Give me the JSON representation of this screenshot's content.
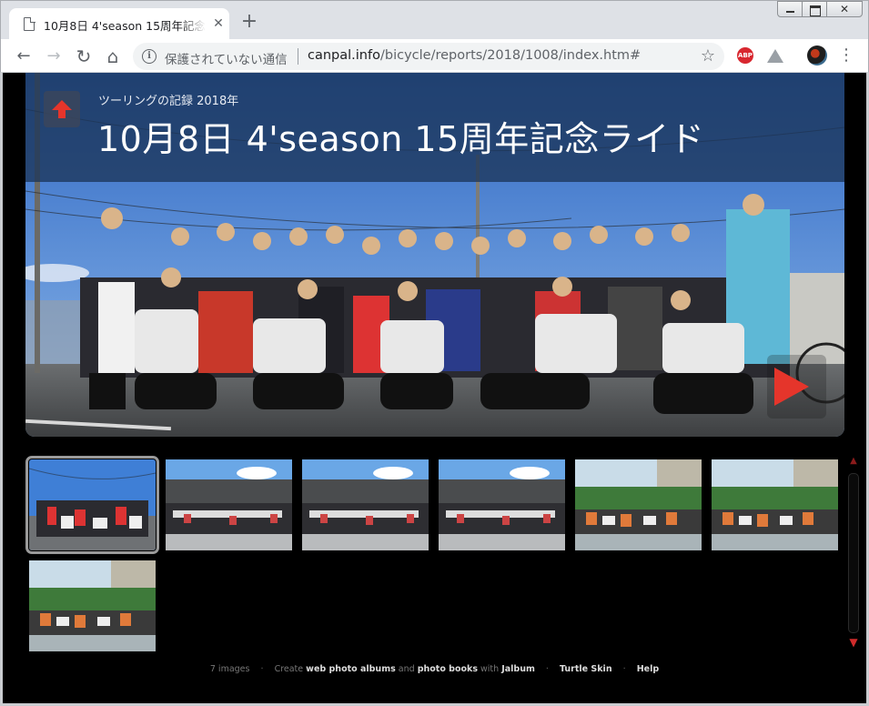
{
  "browser": {
    "tab_title": "10月8日 4'season 15周年記念ライド",
    "tab_close": "✕",
    "new_tab": "+",
    "window_close": "✕",
    "nav_back": "←",
    "nav_forward": "→",
    "nav_reload": "↻",
    "nav_home": "⌂",
    "insecure_label": "保護されていない通信",
    "url_host": "canpal.info",
    "url_path": "/bicycle/reports/2018/1008/index.htm#",
    "star": "☆",
    "menu": "⋮",
    "abp_label": "ABP"
  },
  "page": {
    "breadcrumb": "ツーリングの記録 2018年",
    "title": "10月8日 4'season 15周年記念ライド",
    "thumbnails": [
      {
        "scene": "sky",
        "active": true
      },
      {
        "scene": "building",
        "active": false
      },
      {
        "scene": "building",
        "active": false
      },
      {
        "scene": "building",
        "active": false
      },
      {
        "scene": "green",
        "active": false
      },
      {
        "scene": "green",
        "active": false
      },
      {
        "scene": "green",
        "active": false
      }
    ],
    "footer": {
      "count": "7 images",
      "create": "Create",
      "link_albums": "web photo albums",
      "and": "and",
      "link_books": "photo books",
      "with": "with",
      "link_jalbum": "Jalbum",
      "link_skin": "Turtle Skin",
      "link_help": "Help",
      "separator": "·"
    }
  },
  "colors": {
    "header_overlay": "#1c365a",
    "accent_red": "#d92b2b",
    "sky": "#4a86d8",
    "road": "#5f6265"
  }
}
